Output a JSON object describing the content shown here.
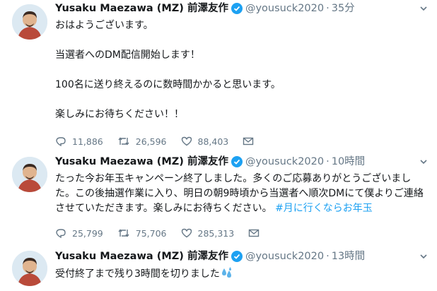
{
  "tweets": [
    {
      "name": "Yusaku Maezawa (MZ) 前澤友作",
      "handle": "@yousuck2020",
      "dot": "·",
      "time": "35分",
      "body": "おはようございます。\n\n当選者へのDM配信開始します！\n\n100名に送り終えるのに数時間かかると思います。\n\n楽しみにお待ちください！！",
      "replies": "11,886",
      "retweets": "26,596",
      "likes": "88,403"
    },
    {
      "name": "Yusaku Maezawa (MZ) 前澤友作",
      "handle": "@yousuck2020",
      "dot": "·",
      "time": "10時間",
      "body": "たった今お年玉キャンペーン終了しました。多くのご応募ありがとうございました。この後抽選作業に入り、明日の朝9時頃から当選者へ順次DMにて僕よりご連絡させていただきます。楽しみにお待ちください。",
      "hashtag": "#月に行くならお年玉",
      "replies": "25,799",
      "retweets": "75,706",
      "likes": "285,313"
    },
    {
      "name": "Yusaku Maezawa (MZ) 前澤友作",
      "handle": "@yousuck2020",
      "dot": "·",
      "time": "13時間",
      "body": "受付終了まで残り3時間を切りました",
      "emoji": "sweat-droplets-icon"
    }
  ],
  "colors": {
    "accent": "#1da1f2",
    "secondary_text": "#657786",
    "divider": "#e6ecf0"
  }
}
